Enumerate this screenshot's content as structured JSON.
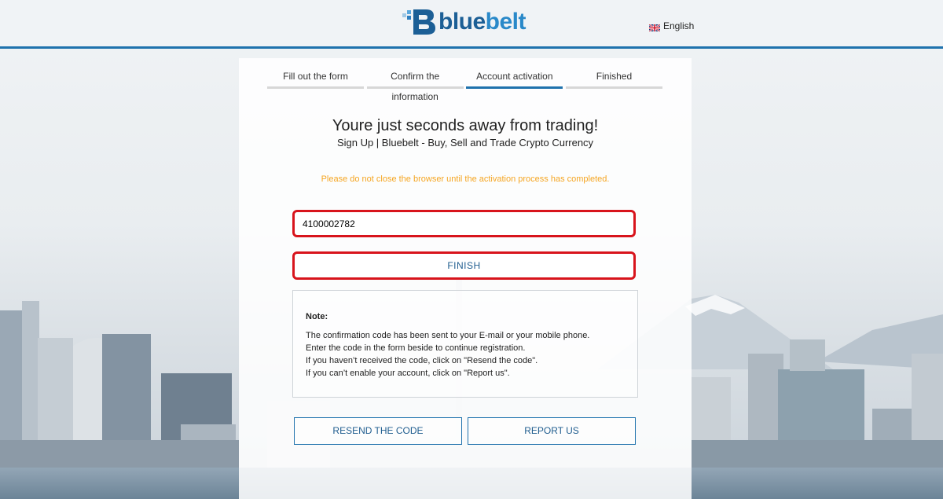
{
  "header": {
    "logo_text_dark": "blue",
    "logo_text_light": "belt",
    "language": "English",
    "flag_icon": "uk-flag-icon"
  },
  "steps": [
    {
      "label": "Fill out the form",
      "active": false
    },
    {
      "label": "Confirm the information",
      "active": false
    },
    {
      "label": "Account activation",
      "active": true
    },
    {
      "label": "Finished",
      "active": false
    }
  ],
  "main": {
    "title": "Youre just seconds away from trading!",
    "subtitle": "Sign Up | Bluebelt - Buy, Sell and Trade Crypto Currency",
    "warning": "Please do not close the browser until the activation process has completed.",
    "code_value": "4100002782",
    "finish_label": "FINISH",
    "note": {
      "title": "Note:",
      "lines": [
        "The confirmation code has been sent to your E-mail or your mobile phone.",
        "Enter the code in the form beside to continue registration.",
        "If you haven’t received the code, click on \"Resend the code\".",
        "If you can’t enable your account, click on \"Report us\"."
      ]
    },
    "resend_label": "RESEND THE CODE",
    "report_label": "REPORT US"
  },
  "colors": {
    "brand_blue": "#1f72ad",
    "warning_orange": "#f5a623",
    "highlight_red": "#d8141c"
  }
}
